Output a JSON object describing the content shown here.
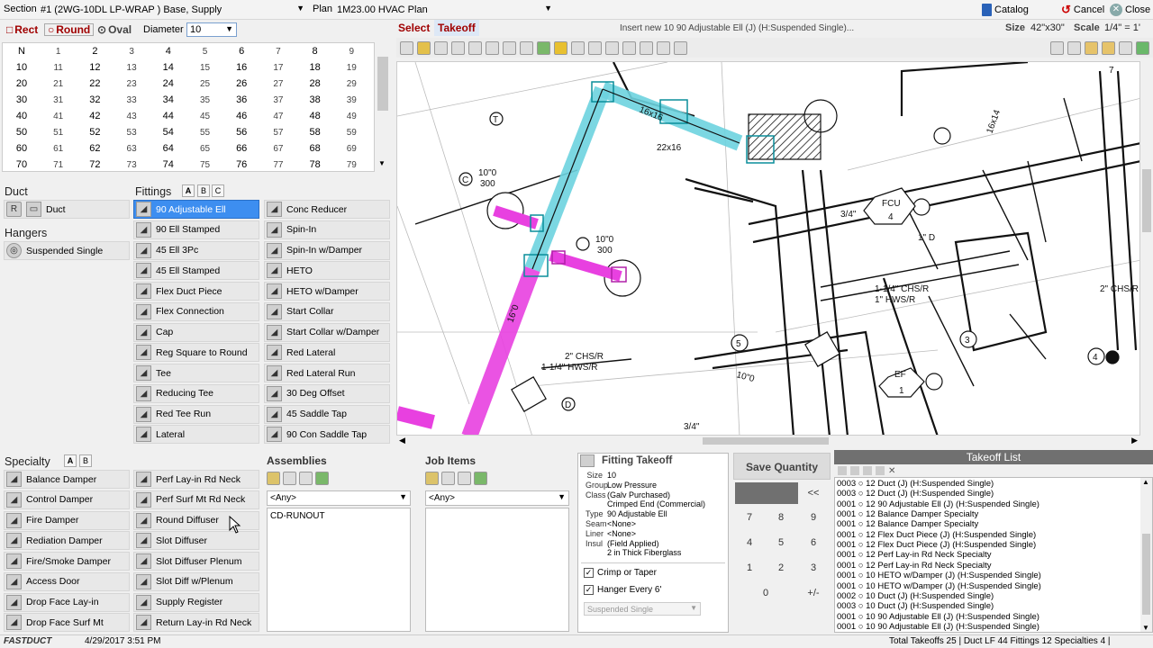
{
  "topbar": {
    "section_label": "Section",
    "section_value": "#1 (2WG-10DL LP-WRAP ) Base, Supply",
    "plan_label": "Plan",
    "plan_value": "1M23.00   HVAC Plan",
    "catalog": "Catalog",
    "cancel": "Cancel",
    "close": "Close"
  },
  "shapes": {
    "rect": "Rect",
    "round": "Round",
    "oval": "Oval",
    "diameter_label": "Diameter",
    "diameter_value": "10"
  },
  "size_grid": [
    [
      "N",
      "1",
      "2",
      "3",
      "4",
      "5",
      "6",
      "7",
      "8",
      "9"
    ],
    [
      "10",
      "11",
      "12",
      "13",
      "14",
      "15",
      "16",
      "17",
      "18",
      "19"
    ],
    [
      "20",
      "21",
      "22",
      "23",
      "24",
      "25",
      "26",
      "27",
      "28",
      "29"
    ],
    [
      "30",
      "31",
      "32",
      "33",
      "34",
      "35",
      "36",
      "37",
      "38",
      "39"
    ],
    [
      "40",
      "41",
      "42",
      "43",
      "44",
      "45",
      "46",
      "47",
      "48",
      "49"
    ],
    [
      "50",
      "51",
      "52",
      "53",
      "54",
      "55",
      "56",
      "57",
      "58",
      "59"
    ],
    [
      "60",
      "61",
      "62",
      "63",
      "64",
      "65",
      "66",
      "67",
      "68",
      "69"
    ],
    [
      "70",
      "71",
      "72",
      "73",
      "74",
      "75",
      "76",
      "77",
      "78",
      "79"
    ]
  ],
  "duct": {
    "title": "Duct",
    "items": [
      "Duct"
    ]
  },
  "hangers": {
    "title": "Hangers",
    "items": [
      "Suspended Single"
    ]
  },
  "fittings": {
    "title": "Fittings",
    "tabs": [
      "A",
      "B",
      "C"
    ],
    "col1": [
      "90 Adjustable Ell",
      "90 Ell Stamped",
      "45 Ell 3Pc",
      "45 Ell Stamped",
      "Flex Duct Piece",
      "Flex Connection",
      "Cap",
      "Reg Square to Round",
      "Tee",
      "Reducing Tee",
      "Red Tee Run",
      "Lateral"
    ],
    "col2": [
      "Conc Reducer",
      "Spin-In",
      "Spin-In w/Damper",
      "HETO",
      "HETO w/Damper",
      "Start Collar",
      "Start Collar w/Damper",
      "Red Lateral",
      "Red Lateral Run",
      "30 Deg Offset",
      "45 Saddle Tap",
      "90 Con Saddle Tap"
    ]
  },
  "specialty": {
    "title": "Specialty",
    "tabs": [
      "A",
      "B"
    ],
    "col1": [
      "Balance Damper",
      "Control Damper",
      "Fire Damper",
      "Rediation Damper",
      "Fire/Smoke Damper",
      "Access Door",
      "Drop Face Lay-in",
      "Drop Face Surf Mt"
    ],
    "col2": [
      "Perf Lay-in Rd Neck",
      "Perf Surf Mt Rd Neck",
      "Round Diffuser",
      "Slot Diffuser",
      "Slot Diffuser Plenum",
      "Slot Diff w/Plenum",
      "Supply Register",
      "Return Lay-in Rd Neck"
    ]
  },
  "drawing_header": {
    "select": "Select",
    "takeoff": "Takeoff",
    "insert_msg": "Insert new 10 90 Adjustable Ell (J) (H:Suspended Single)...",
    "size_label": "Size",
    "size_value": "42\"x30\"",
    "scale_label": "Scale",
    "scale_value": "1/4\" = 1'"
  },
  "drawing_labels": [
    "16x16",
    "22x16",
    "10\"0",
    "300",
    "10\"0",
    "300",
    "16\"0",
    "FCU",
    "4",
    "3/4\"",
    "1\" D",
    "1-1/4\" CHS/R",
    "1\" HWS/R",
    "2\" CHS/R",
    "1-1/4\" HWS/R",
    "EF",
    "1",
    "5",
    "3",
    "4",
    "D",
    "T",
    "C",
    "16x14",
    "2\" CHS/R",
    "10\"0",
    "3/4\"",
    "7"
  ],
  "assemblies": {
    "title": "Assemblies",
    "filter": "<Any>",
    "items": [
      "CD-RUNOUT"
    ]
  },
  "job_items": {
    "title": "Job Items",
    "filter": "<Any>"
  },
  "fitting_takeoff": {
    "title": "Fitting Takeoff",
    "rows": [
      {
        "k": "Size",
        "v": "10"
      },
      {
        "k": "Group",
        "v": "Low Pressure"
      },
      {
        "k": "Class",
        "v": "(Galv Purchased)"
      },
      {
        "k": "",
        "v": "Crimped End (Commercial)"
      },
      {
        "k": "Type",
        "v": "90 Adjustable Ell"
      },
      {
        "k": "Seam",
        "v": "<None>"
      },
      {
        "k": "Liner",
        "v": "<None>"
      },
      {
        "k": "Insul",
        "v": "(Field Applied)"
      },
      {
        "k": "",
        "v": "2 in Thick Fiberglass"
      }
    ],
    "crimp": "Crimp or Taper",
    "hanger": "Hanger Every 6'",
    "hanger_type": "Suspended Single"
  },
  "keypad": {
    "save": "Save Quantity",
    "back": "<<",
    "keys": [
      "7",
      "8",
      "9",
      "4",
      "5",
      "6",
      "1",
      "2",
      "3",
      "0",
      "+/-"
    ]
  },
  "takeoff_list": {
    "title": "Takeoff List",
    "rows": [
      "0003 ○ 12 Duct (J) (H:Suspended Single)",
      "0003 ○ 12 Duct (J) (H:Suspended Single)",
      "0001 ○ 12 90 Adjustable Ell (J) (H:Suspended Single)",
      "0001 ○ 12 Balance Damper Specialty",
      "0001 ○ 12 Balance Damper Specialty",
      "0001 ○ 12 Flex Duct Piece (J) (H:Suspended Single)",
      "0001 ○ 12 Flex Duct Piece (J) (H:Suspended Single)",
      "0001 ○ 12 Perf Lay-in Rd Neck Specialty",
      "0001 ○ 12 Perf Lay-in Rd Neck Specialty",
      "0001 ○ 10 HETO w/Damper (J) (H:Suspended Single)",
      "0001 ○ 10 HETO w/Damper (J) (H:Suspended Single)",
      "0002 ○ 10 Duct (J) (H:Suspended Single)",
      "0003 ○ 10 Duct (J) (H:Suspended Single)",
      "0001 ○ 10 90 Adjustable Ell (J) (H:Suspended Single)",
      "0001 ○ 10 90 Adjustable Ell (J) (H:Suspended Single)"
    ]
  },
  "status": {
    "brand": "FASTDUCT",
    "date": "4/29/2017 3:51 PM",
    "totals": "Total Takeoffs  25   | Duct LF  44  Fittings  12  Specialties  4  |"
  }
}
